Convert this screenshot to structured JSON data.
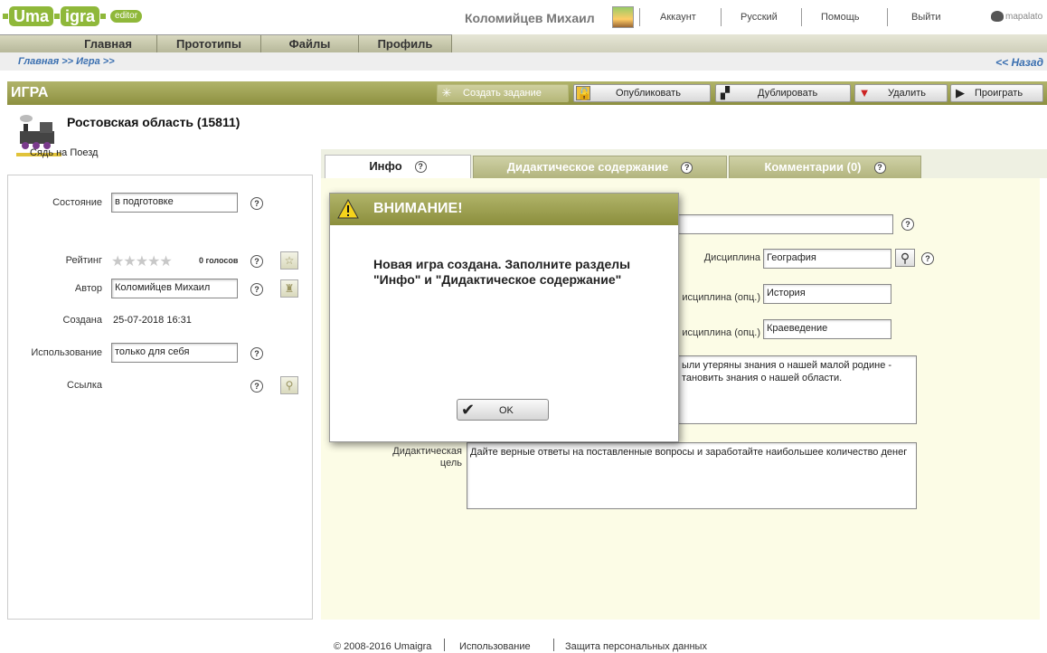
{
  "header": {
    "logo_part1": "Uma",
    "logo_part2": "igra",
    "logo_badge": "editor",
    "user_name": "Коломийцев Михаил",
    "links": [
      "Аккаунт",
      "Русский",
      "Помощь",
      "Выйти"
    ],
    "partner": "mapalato"
  },
  "nav": {
    "tabs": [
      "Главная",
      "Прототипы",
      "Файлы",
      "Профиль"
    ]
  },
  "breadcrumb": {
    "path": "Главная >> Игра >>",
    "back": "<< Назад"
  },
  "titlebar": {
    "title": "ИГРА",
    "create_task": "Создать задание",
    "publish": "Опубликовать",
    "duplicate": "Дублировать",
    "delete": "Удалить",
    "play": "Проиграть"
  },
  "game": {
    "title": "Ростовская область (15811)",
    "subtitle": "Сядь на Поезд"
  },
  "left": {
    "state_label": "Состояние",
    "state_value": "в подготовке",
    "rating_label": "Рейтинг",
    "rating_stars": "★★★★★",
    "rating_votes": "0 голосов",
    "author_label": "Автор",
    "author_value": "Коломийцев Михаил",
    "created_label": "Создана",
    "created_value": "25-07-2018 16:31",
    "usage_label": "Использование",
    "usage_value": "только для себя",
    "link_label": "Ссылка",
    "help": "?"
  },
  "content_tabs": {
    "info": "Инфо",
    "didactic": "Дидактическое содержание",
    "comments": "Комментарии (0)",
    "help": "?"
  },
  "info": {
    "discipline_label": "Дисциплина",
    "discipline_value": "География",
    "discipline2_label": "исциплина (опц.)",
    "discipline2_value": "История",
    "discipline3_label": "исциплина (опц.)",
    "discipline3_value": "Краеведение",
    "description_line1": "ыли утеряны знания о нашей малой родине -",
    "description_line2": "тановить знания о нашей области.",
    "goal_label_1": "Дидактическая",
    "goal_label_2": "цель",
    "goal_value": "Дайте верные ответы на поставленные вопросы и заработайте наибольшее количество денег"
  },
  "modal": {
    "title": "ВНИМАНИЕ!",
    "message": "Новая игра создана. Заполните разделы \"Инфо\" и \"Дидактическое содержание\"",
    "ok": "OK"
  },
  "footer": {
    "copyright": "© 2008-2016 Umaigra",
    "usage": "Использование",
    "privacy": "Защита персональных данных"
  }
}
